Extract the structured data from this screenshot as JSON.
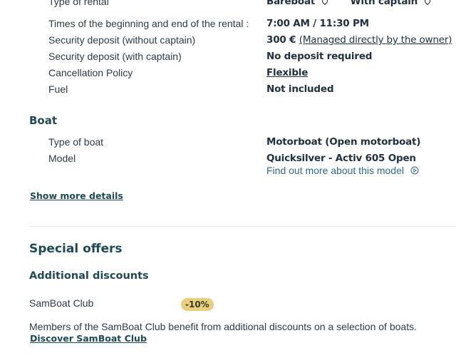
{
  "rental": {
    "type_label": "Type of rental",
    "type_bareboat": "Bareboat",
    "type_captain": "With captain",
    "times_label": "Times of the beginning and end of the rental :",
    "times_value": "7:00 AM / 11:30 PM",
    "deposit_no_captain_label": "Security deposit (without captain)",
    "deposit_no_captain_amount": "300 €",
    "deposit_no_captain_note": "(Managed directly by the owner)",
    "deposit_captain_label": "Security deposit (with captain)",
    "deposit_captain_value": "No deposit required",
    "cancellation_label": "Cancellation Policy",
    "cancellation_value": "Flexible",
    "fuel_label": "Fuel",
    "fuel_value": "Not included"
  },
  "boat": {
    "heading": "Boat",
    "type_label": "Type of boat",
    "type_value": "Motorboat (Open motorboat)",
    "model_label": "Model",
    "model_value": "Quicksilver - Activ 605 Open",
    "model_link": "Find out more about this model"
  },
  "show_more": "Show more details",
  "offers": {
    "heading": "Special offers",
    "sub_heading": "Additional discounts",
    "club_label": "SamBoat Club",
    "club_badge": "-10%",
    "club_desc": "Members of the SamBoat Club benefit from additional discounts on a selection of boats.",
    "club_link": "Discover SamBoat Club"
  },
  "colors": {
    "heading": "#1d4a55",
    "link": "#2d6a86",
    "badge": "#e7cf7d"
  }
}
